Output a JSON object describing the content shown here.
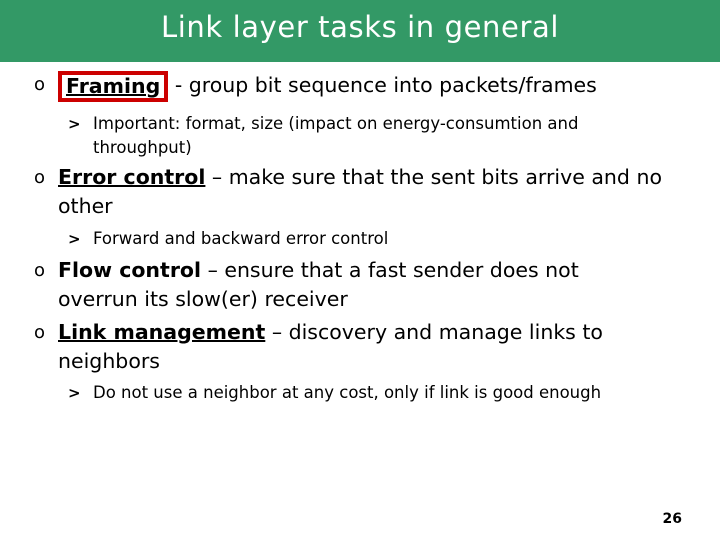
{
  "slide": {
    "title": "Link layer tasks in general",
    "page_number": "26",
    "colors": {
      "banner_green": "#339966",
      "highlight_red": "#cc0000",
      "title_text": "#ffffff",
      "body_text": "#000000",
      "background": "#ffffff"
    },
    "markers": {
      "level1": "o",
      "level2": ">"
    }
  },
  "content": {
    "bullets": [
      {
        "level": 1,
        "marker": "o",
        "term": "Framing",
        "term_style": "boxed-underline-bold",
        "rest": " - group bit sequence into packets/frames"
      },
      {
        "level": 2,
        "marker": ">",
        "text": "Important: format, size (impact on energy-consumtion and throughput)"
      },
      {
        "level": 1,
        "marker": "o",
        "term": "Error control",
        "term_style": "underline-bold",
        "rest": " – make sure that the sent bits arrive and no other"
      },
      {
        "level": 2,
        "marker": ">",
        "text": "Forward and backward error control"
      },
      {
        "level": 1,
        "marker": "o",
        "term": "Flow control",
        "term_style": "bold",
        "rest": " – ensure that a fast sender does not overrun its slow(er) receiver"
      },
      {
        "level": 1,
        "marker": "o",
        "term": "Link management",
        "term_style": "underline-bold",
        "rest": " – discovery and manage links to neighbors"
      },
      {
        "level": 2,
        "marker": ">",
        "text": "Do not use a neighbor at any cost, only if link is good enough"
      }
    ]
  }
}
